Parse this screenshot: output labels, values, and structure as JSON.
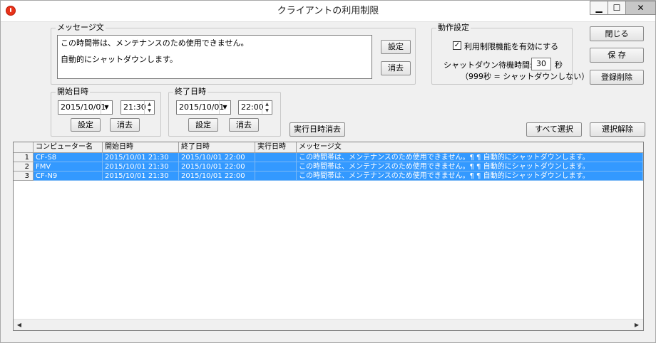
{
  "window": {
    "title": "クライアントの利用制限",
    "minimize_glyph": "▁",
    "maximize_glyph": "☐",
    "close_glyph": "✕"
  },
  "message_group": {
    "legend": "メッセージ文",
    "lines": [
      "この時間帯は、メンテナンスのため使用できません。",
      "自動的にシャットダウンします。"
    ],
    "set_button": "設定",
    "clear_button": "消去"
  },
  "operation_group": {
    "legend": "動作設定",
    "enable_checkbox_checked": true,
    "enable_label": "利用制限機能を有効にする",
    "shutdown_wait_label": "シャットダウン待機時間:",
    "shutdown_wait_value": "30",
    "shutdown_wait_unit": "秒",
    "note": "（999秒 = シャットダウンしない）"
  },
  "right_buttons": {
    "close": "閉じる",
    "save": "保 存",
    "delete_registration": "登録削除"
  },
  "start_group": {
    "legend": "開始日時",
    "date": "2015/10/01",
    "time": "21:30",
    "set_button": "設定",
    "clear_button": "消去"
  },
  "end_group": {
    "legend": "終了日時",
    "date": "2015/10/01",
    "time": "22:00",
    "set_button": "設定",
    "clear_button": "消去"
  },
  "actions": {
    "clear_exec_time": "実行日時消去",
    "select_all": "すべて選択",
    "deselect": "選択解除"
  },
  "grid": {
    "columns": [
      "コンピューター名",
      "開始日時",
      "終了日時",
      "実行日時",
      "メッセージ文"
    ],
    "rows": [
      {
        "num": "1",
        "computer": "CF-S8",
        "start": "2015/10/01 21:30",
        "end": "2015/10/01 22:00",
        "executed": "",
        "message": "この時間帯は、メンテナンスのため使用できません。¶ ¶ 自動的にシャットダウンします。"
      },
      {
        "num": "2",
        "computer": "FMV",
        "start": "2015/10/01 21:30",
        "end": "2015/10/01 22:00",
        "executed": "",
        "message": "この時間帯は、メンテナンスのため使用できません。¶ ¶ 自動的にシャットダウンします。"
      },
      {
        "num": "3",
        "computer": "CF-N9",
        "start": "2015/10/01 21:30",
        "end": "2015/10/01 22:00",
        "executed": "",
        "message": "この時間帯は、メンテナンスのため使用できません。¶ ¶ 自動的にシャットダウンします。"
      }
    ],
    "selected_color": "#3399ff"
  }
}
